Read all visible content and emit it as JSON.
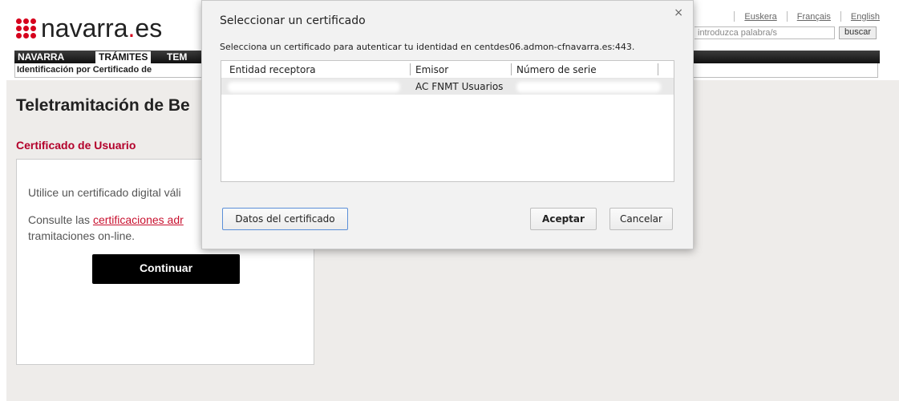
{
  "logo": {
    "text_main": "navarra",
    "text_dot": ".",
    "text_tld": "es"
  },
  "header": {
    "languages": [
      "Euskera",
      "Français",
      "English"
    ],
    "search_placeholder": "introduzca palabra/s",
    "search_button": "buscar"
  },
  "nav": {
    "items": [
      "NAVARRA",
      "TRÁMITES",
      "TEM"
    ]
  },
  "breadcrumb": "Identificación por Certificado de",
  "page": {
    "title": "Teletramitación de Be",
    "section_title": "Certificado de Usuario",
    "line1": "Utilice un certificado digital váli",
    "line2_prefix": "Consulte las ",
    "line2_link": "certificaciones adr",
    "line3": "tramitaciones on-line.",
    "continue_button": "Continuar"
  },
  "dialog": {
    "title": "Seleccionar un certificado",
    "close": "×",
    "description": "Selecciona un certificado para autenticar tu identidad en centdes06.admon-cfnavarra.es:443.",
    "columns": [
      "Entidad receptora",
      "Emisor",
      "Número de serie"
    ],
    "rows": [
      {
        "emisor": "AC FNMT Usuarios"
      }
    ],
    "buttons": {
      "details": "Datos del certificado",
      "accept": "Aceptar",
      "cancel": "Cancelar"
    }
  },
  "colors": {
    "brand_red": "#d6001c",
    "section_red": "#b3002b",
    "link_red": "#c8102e",
    "page_gray": "#eeecea"
  }
}
